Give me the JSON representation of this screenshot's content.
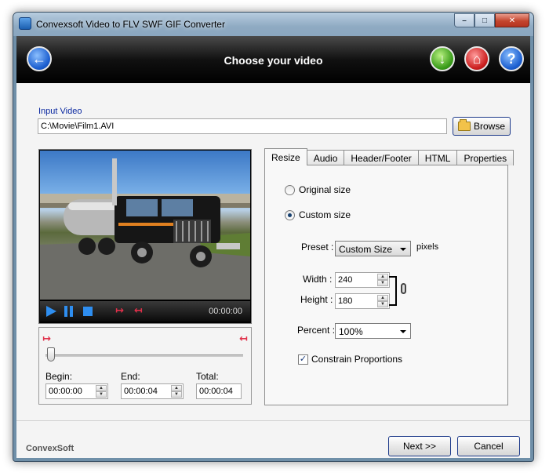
{
  "window": {
    "title": "Convexsoft Video to FLV  SWF  GIF Converter",
    "minimize": "–",
    "maximize": "□",
    "close": "✕"
  },
  "header": {
    "page_title": "Choose your video",
    "back_glyph": "←",
    "download_glyph": "↓",
    "home_glyph": "⌂",
    "help_glyph": "?"
  },
  "input": {
    "label": "Input Video",
    "path": "C:\\Movie\\Film1.AVI",
    "browse_label": "Browse"
  },
  "player": {
    "time": "00:00:00",
    "mark_in_glyph": "↦",
    "mark_out_glyph": "↤"
  },
  "trim": {
    "begin_label": "Begin:",
    "end_label": "End:",
    "total_label": "Total:",
    "begin_value": "00:00:00",
    "end_value": "00:00:04",
    "total_value": "00:00:04",
    "slider_position": 0
  },
  "tabs": [
    {
      "label": "Resize",
      "active": true
    },
    {
      "label": "Audio",
      "active": false
    },
    {
      "label": "Header/Footer",
      "active": false
    },
    {
      "label": "HTML",
      "active": false
    },
    {
      "label": "Properties",
      "active": false
    }
  ],
  "resize": {
    "original_size_label": "Original size",
    "custom_size_label": "Custom size",
    "selected": "custom",
    "preset_label": "Preset :",
    "preset_value": "Custom Size",
    "pixels_label": "pixels",
    "width_label": "Width :",
    "width_value": "240",
    "height_label": "Height :",
    "height_value": "180",
    "percent_label": "Percent :",
    "percent_value": "100%",
    "constrain_label": "Constrain Proportions",
    "constrain_checked": true
  },
  "footer": {
    "brand": "ConvexSoft",
    "next_label": "Next >>",
    "cancel_label": "Cancel"
  },
  "colors": {
    "accent_blue": "#2e8ef0",
    "marker_red": "#e0304a",
    "label_blue": "#0a28a0"
  }
}
